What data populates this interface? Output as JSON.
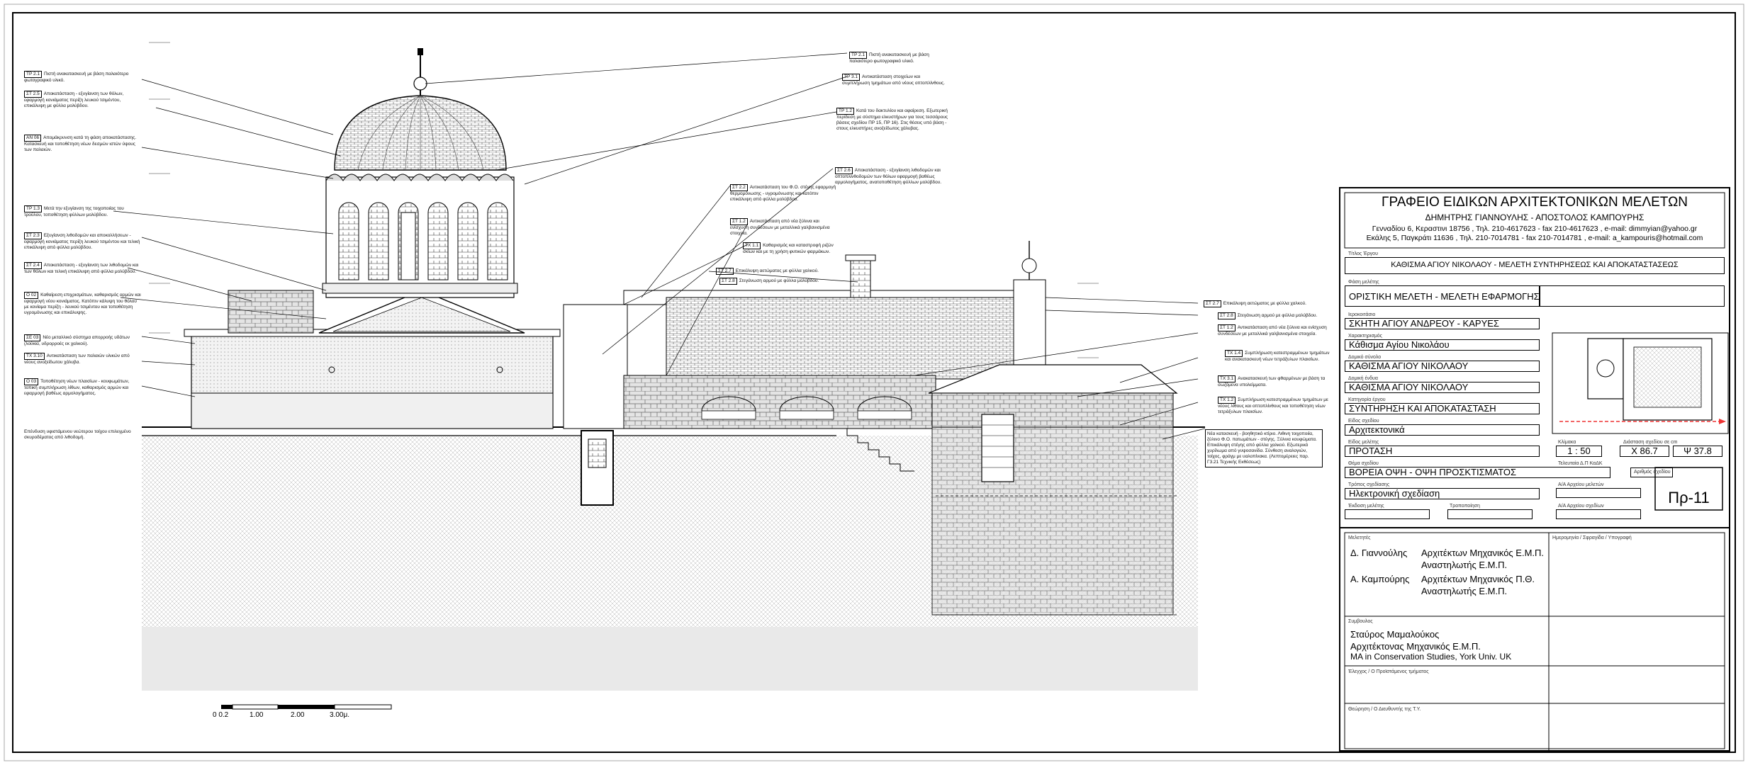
{
  "office": {
    "name": "ΓΡΑΦΕΙΟ ΕΙΔΙΚΩΝ ΑΡΧΙΤΕΚΤΟΝΙΚΩΝ ΜΕΛΕΤΩΝ",
    "partners": "ΔΗΜΗΤΡΗΣ ΓΙΑΝΝΟΥΛΗΣ  -  ΑΠΟΣΤΟΛΟΣ ΚΑΜΠΟΥΡΗΣ",
    "address1": "Γενναδίου 6, Κεραστινι 18756 , Τηλ. 210-4617623 - fax 210-4617623 , e-mail: dimmyian@yahoo.gr",
    "address2": "Εκάλης 5, Παγκράτι 11636 , Τηλ. 210-7014781 - fax 210-7014781 , e-mail: a_kampouris@hotmail.com"
  },
  "titleblock": {
    "project_label": "Τίτλος Έργου",
    "project": "ΚΑΘΙΣΜΑ ΑΓΙΟΥ ΝΙΚΟΛΑΟΥ - ΜΕΛΕΤΗ ΣΥΝΤΗΡΗΣΕΩΣ ΚΑΙ ΑΠΟΚΑΤΑΣΤΑΣΕΩΣ",
    "phase_label": "Φάση μελέτης",
    "phase": "ΟΡΙΣΤΙΚΗ ΜΕΛΕΤΗ - ΜΕΛΕΤΗ ΕΦΑΡΜΟΓΗΣ",
    "location_label": "Ιεροκοιτάσιο",
    "location": "ΣΚΗΤΗ ΑΓΙΟΥ ΑΝΔΡΕΟΥ - ΚΑΡΥΕΣ",
    "char_label": "Χαρακτηρισμός",
    "char": "Κάθισμα Αγίου Νικολάου",
    "complex_label": "Δομικό σύνολο",
    "complex": "ΚΑΘΙΣΜΑ ΑΓΙΟΥ ΝΙΚΟΛΑΟΥ",
    "unit_label": "Δομική ένδυα",
    "unit": "ΚΑΘΙΣΜΑ ΑΓΙΟΥ ΝΙΚΟΛΑΟΥ",
    "category_label": "Κατηγορία έργου",
    "category": "ΣΥΝΤΗΡΗΣΗ ΚΑΙ ΑΠΟΚΑΤΑΣΤΑΣΗ",
    "type_label": "Είδος σχεδίου",
    "type": "Αρχιτεκτονικά",
    "design_type_label": "Είδος μελέτης",
    "design_type": "ΠΡΟΤΑΣΗ",
    "scale_label": "Κλίμακα",
    "scale": "1 : 50",
    "coords_label": "Διάσταση σχεδίου σε cm",
    "x": "Χ  86.7",
    "y": "Ψ  37.8",
    "drawing_title_label": "Θέμα σχεδίου",
    "drawing_title": "ΒΟΡΕΙΑ ΟΨΗ - ΟΨΗ ΠΡΟΣΚΤΙΣΜΑΤΟΣ",
    "drawing_number_label": "Αριθμός σχεδίου",
    "drawing_number": "Πρ-11",
    "method_label": "Τρόπος σχεδίασης",
    "method": "Ηλεκτρονική σχεδίαση",
    "arch_label": "Α/Α Αρχείου μελετών",
    "file_label": "Α/Α Αρχείου σχεδίων",
    "version_label": "Έκδοση μελέτης",
    "revision_label": "Τροποποίηση",
    "site_label": "Τελευταία Δ.Π ΚαΔΚ",
    "designers_label": "Μελετητές",
    "date_label": "Ημερομηνία / Σφραγίδα / Υπογραφή",
    "designers": [
      {
        "name": "Δ. Γιαννούλης",
        "title1": "Αρχιτέκτων Μηχανικός Ε.Μ.Π.",
        "title2": "Αναστηλωτής Ε.Μ.Π."
      },
      {
        "name": "Α. Καμπούρης",
        "title1": "Αρχιτέκτων Μηχανικός Π.Θ.",
        "title2": "Αναστηλωτής Ε.Μ.Π."
      }
    ],
    "collab_label": "Συμβουλος",
    "collab_name": "Σταύρος  Μαμαλούκος",
    "collab_title1": "Αρχιτέκτονας Μηχανικός Ε.Μ.Π.",
    "collab_title2": "MA in Conservation Studies, York Univ. UK",
    "check_label": "Έλεγχος / Ο Προϊστάμενος τμήματος",
    "approve_label": "Θεώρηση / Ο Διευθυντής της Τ.Υ."
  },
  "scalebar": {
    "ticks": [
      "0 0.2",
      "1.00",
      "2.00",
      "3.00μ."
    ]
  },
  "notes_left": [
    {
      "tag": "ΤΡ 2.1",
      "text": "Πιστή ανακατασκευή με βάση παλαιότερο φωτογραφικό υλικό."
    },
    {
      "tag": "ΣΤ 2.5",
      "text": "Αποκατάσταση - εξυγίανση των θόλων, εφαρμογή κονιάματος περίζη λευκού τσιμέντου, επικάλυψη με φύλλα μολύβδου."
    },
    {
      "tag": "ΑΝ 06",
      "text": "Απομάκρυνση κατά τη φάση αποκατάστασης. Κατασκευή και τοποθέτηση νέων δεσμών ιστών ύψους των παλαιών."
    },
    {
      "tag": "ΤΡ 1.3",
      "text": "Μετά την εξυγίανση της τοιχοποιίας του τρούλου, τοποθέτηση φύλλων μολύβδου."
    },
    {
      "tag": "ΣΤ 2.3",
      "text": "Εξυγίανση λιθοδομών και αποκολλήσεων - εφαρμογή κονιάματος περίζη λευκού τσιμέντου και τελική επικάλυψη από φύλλα μολύβδου."
    },
    {
      "tag": "ΣΤ 2.4",
      "text": "Αποκατάσταση - εξυγίανση των λιθοδομών και των θόλων και τελική επικάλυψη από φύλλα μολύβδου."
    },
    {
      "tag": "Ο 02",
      "text": "Καθαίρεση επιχρισμάτων, καθαρισμός αρμών και εφαρμογή νέου κονιάματος. Κατόπιν κάλυψη του θόλου με κονίαμα περίζη - λευκού τσιμέντου και τοποθέτηση υγρομόνωσης και επικάλυψης."
    },
    {
      "tag": "ΣΕ 03",
      "text": "Νέο μεταλλικό σύστημα απορροής υδάτων (λούκια, υδρορροές εκ χαλκού)."
    },
    {
      "tag": "ΤΧ 3.10",
      "text": "Αντικατάσταση των παλαιών υλικών από νέους ανοξείδωτου χάλυβα."
    },
    {
      "tag": "Ο 03",
      "text": "Τοποθέτηση νέων πλαισίων - κουφωμάτων, τοπική συμπλήρωση λίθων, καθαρισμός αρμών και εφαρμογή βαθέως αρμολογήματος."
    }
  ],
  "note_bottom_left": "Επένδυση υφιστάμενου νεώτερου τοίχου επιλεγμένο σκυροδέματος από λιθοδομή.",
  "notes_top": [
    {
      "tag": "ΤΡ 2.1",
      "text": "Πιστή ανακατασκευή με βάση παλαιότερο φωτογραφικό υλικό."
    },
    {
      "tag": "ΤΡ 3.1",
      "text": "Αντικατάσταση στοιχείων και συμπλήρωση τμημάτων από νέους οπτοπλίνθους."
    },
    {
      "tag": "ΤΡ 1.2",
      "text": "Κατά του δακτυλίου και αφαίρεση. Εξωτερική περίδεση με σύστημα ελκυστήρων για τους τεσσάρους βάσεις σχεδίου ΠΡ 15, ΠΡ 16). Στις θέσεις υπό βάση - στους ελκυστήρες ανοξείδωτος χάλυβας."
    },
    {
      "tag": "ΣΤ 2.6",
      "text": "Αποκατάσταση - εξυγίανση λιθοδομών και οπτοπλινθοδομών των θόλων εφαρμογή βαθέως αρμολογήματος, ανατοποθέτηση φύλλων μολύβδου."
    },
    {
      "tag": "ΣΤ 2.2",
      "text": "Αντικατάσταση του Φ.Ο. στέγης εφαρμογή θερμομόνωσης - υγρομόνωσης και κατόπιν επικάλυψη από φύλλα μολύβδου."
    },
    {
      "tag": "ΣΤ 1.2",
      "text": "Αντικατάσταση από νέα ξύλινα και ενίσχυση συνδέσεων με μεταλλικά γαλβανισμένα στοιχεία."
    },
    {
      "tag": "ΤΧ 1.1",
      "text": "Καθαρισμός και καταστροφή ριζών σκίων και με τη χρήση φυτικών φαρμάκων."
    },
    {
      "tag": "ΣΤ 2.7",
      "text": "Επικάλυψη αετώματος με φύλλα χαλκού."
    },
    {
      "tag": "ΣΤ 2.8",
      "text": "Στεγάνωση αρμού με φύλλα μολύβδου."
    }
  ],
  "notes_right": [
    {
      "tag": "ΣΤ 2.7",
      "text": "Επικάλυψη αετώματος με φύλλα χαλκού."
    },
    {
      "tag": "ΣΤ 2.8",
      "text": "Στεγάνωση αρμού με φύλλα μολύβδου."
    },
    {
      "tag": "ΣΤ 1.2",
      "text": "Αντικατάσταση από νέα ξύλινα και ενίσχυση συνδέσεων με μεταλλικά γαλβανισμένα στοιχεία."
    },
    {
      "tag": "ΤΧ 1.4",
      "text": "Συμπλήρωση κατεστραμμένων τμημάτων και ανακατασκευή νέων τετράξυλων πλαισίων."
    },
    {
      "tag": "ΤΧ 3.1",
      "text": "Ανακατασκευή των φθαρμένων με βάση τα σωζόμενα υπολείμματα."
    },
    {
      "tag": "ΤΧ 1.2",
      "text": "Συμπλήρωση κατεστραμμένων τμημάτων με νέους λίθους και οπτοπλίνθους και τοποθέτηση νέων τετράξυλων πλαισίων."
    }
  ],
  "note_bottom_right": "Νέα κατασκευή - βοηθητικό κτίριο. Λιθινη τοιχοποιία, ξύλινο Φ.Ο. πατωμάτων - στέγης. Ξύλινα κουφώματα. Επικάλυψη στέγης από φύλλα χαλκού. Εξωτερικό χυρίλωμα από γυψοσανίδα. Σύνθεση αναλογιών, τοίχος, φράγμ με υαλοπίνακα. (Λεπτομέρειες παρ. Γ3.21 Τεχνικής Εκθέσεως)"
}
